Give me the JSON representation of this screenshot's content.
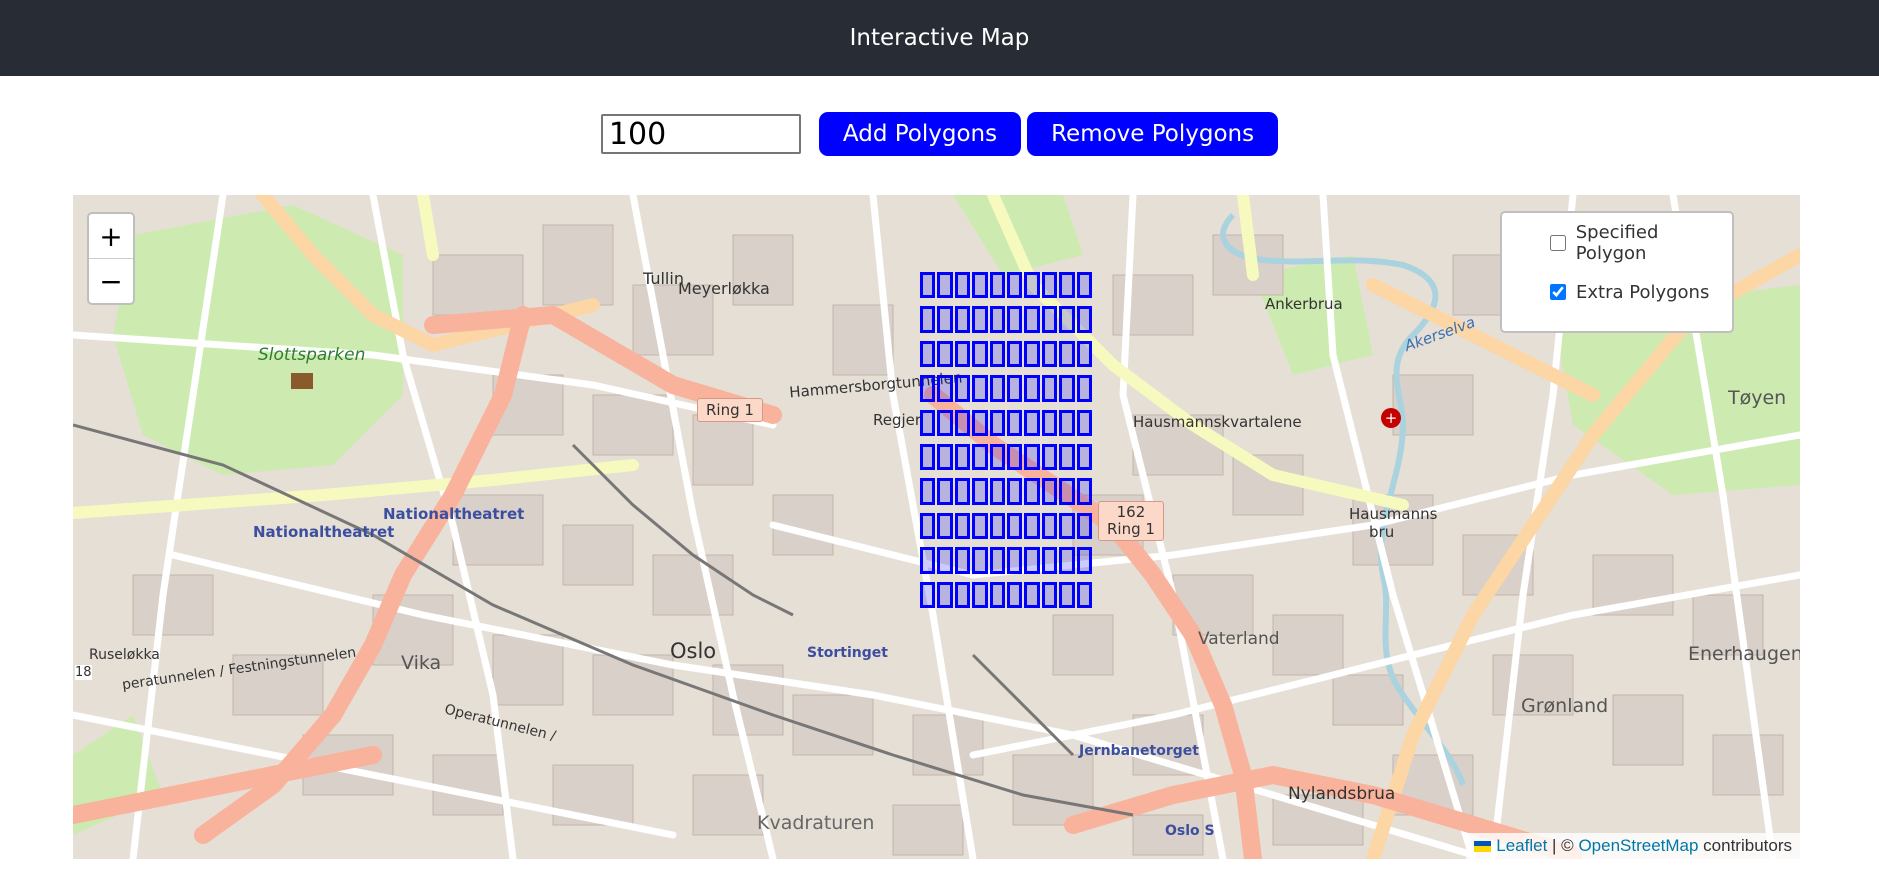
{
  "header": {
    "title": "Interactive Map"
  },
  "controls": {
    "count_value": "100",
    "add_label": "Add Polygons",
    "remove_label": "Remove Polygons"
  },
  "map": {
    "zoom_in": "+",
    "zoom_out": "−",
    "layers": [
      {
        "label": "Specified Polygon",
        "checked": false
      },
      {
        "label": "Extra Polygons",
        "checked": true
      }
    ],
    "attribution": {
      "leaflet": "Leaflet",
      "separator": " | © ",
      "osm": "OpenStreetMap",
      "suffix": " contributors"
    },
    "polygon_grid": {
      "rows": 10,
      "cols": 10,
      "color": "#0000ff"
    },
    "place_labels": {
      "tullin": "Tullin",
      "meyerlokka": "Meyerløkka",
      "slottsparken": "Slottsparken",
      "nationaltheatret1": "Nationaltheatret",
      "nationaltheatret2": "Nationaltheatret",
      "oslo": "Oslo",
      "vika": "Vika",
      "ruselokka": "Ruseløkka",
      "stortinget": "Stortinget",
      "kvadraturen": "Kvadraturen",
      "jernbanetorget": "Jernbanetorget",
      "oslo_s": "Oslo S",
      "nylandsbrua": "Nylandsbrua",
      "gronland": "Grønland",
      "enerhaugen": "Enerhaugen",
      "toyen": "Tøyen",
      "vaterland": "Vaterland",
      "ankerbrua": "Ankerbrua",
      "hausmannskvartalene": "Hausmannskvartalene",
      "hausmanns_bru_1": "Hausmanns",
      "hausmanns_bru_2": "bru",
      "regjeringskvartalet": "Regjer",
      "hammersborgtunnelen": "Hammersborgtunnelen",
      "festningstunnelen": "peratunnelen / Festningstunnelen",
      "operatunnelen": "Operatunnelen /",
      "route_18": "18",
      "akerselva": "Akerselva"
    },
    "shields": {
      "ring1_a": "Ring 1",
      "ring1_b_num": "162",
      "ring1_b_name": "Ring 1"
    },
    "colors": {
      "park": "#cdebb0",
      "building": "#d9d0c9",
      "motorway": "#e8927c",
      "trunk": "#f9b29c",
      "primary": "#fcd6a4",
      "secondary": "#f7fabf",
      "water": "#aad3df"
    }
  }
}
